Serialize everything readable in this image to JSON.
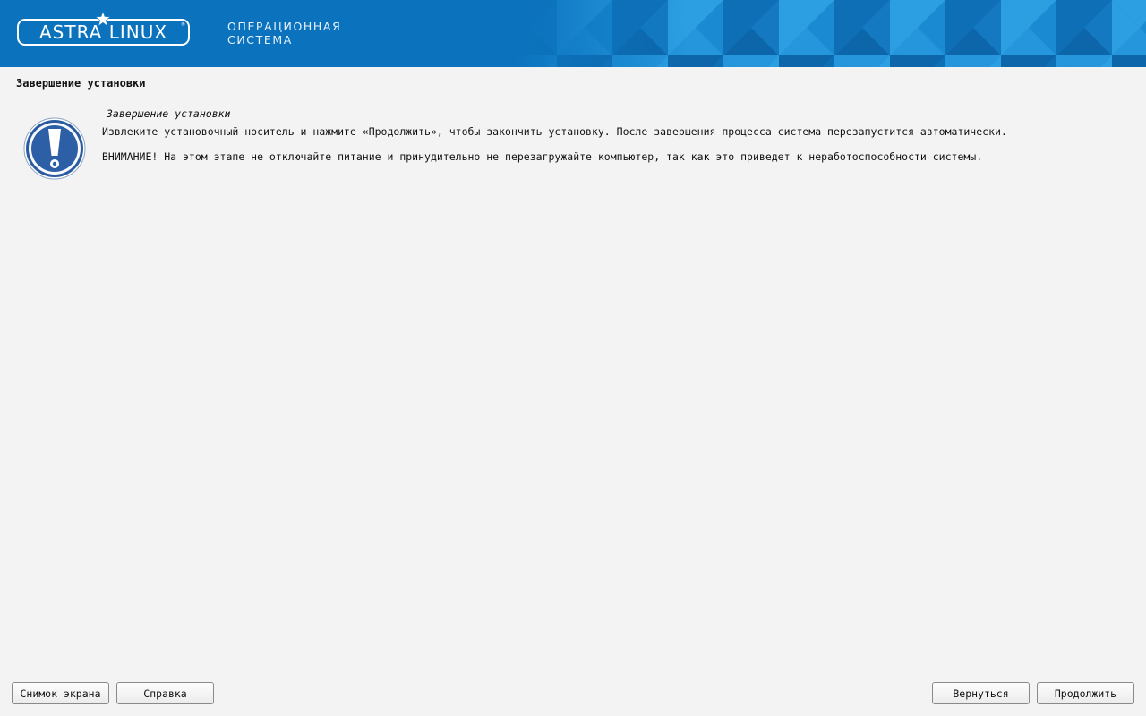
{
  "header": {
    "logo_text": "ASTRA LINUX",
    "logo_trademark": "®",
    "subtitle_line1": "ОПЕРАЦИОННАЯ",
    "subtitle_line2": "СИСТЕМА",
    "background_color": "#1b82c8"
  },
  "page": {
    "title": "Завершение установки"
  },
  "message": {
    "icon": "warning-exclamation-icon",
    "title": "Завершение установки",
    "line1": "Извлеките установочный носитель и нажмите «Продолжить», чтобы закончить установку. После завершения процесса система перезапустится автоматически.",
    "line2": "ВНИМАНИЕ! На этом этапе не отключайте питание и принудительно не перезагружайте компьютер, так как это приведет к неработоспособности системы."
  },
  "buttons": {
    "screenshot": "Снимок экрана",
    "help": "Справка",
    "back": "Вернуться",
    "continue": "Продолжить"
  }
}
